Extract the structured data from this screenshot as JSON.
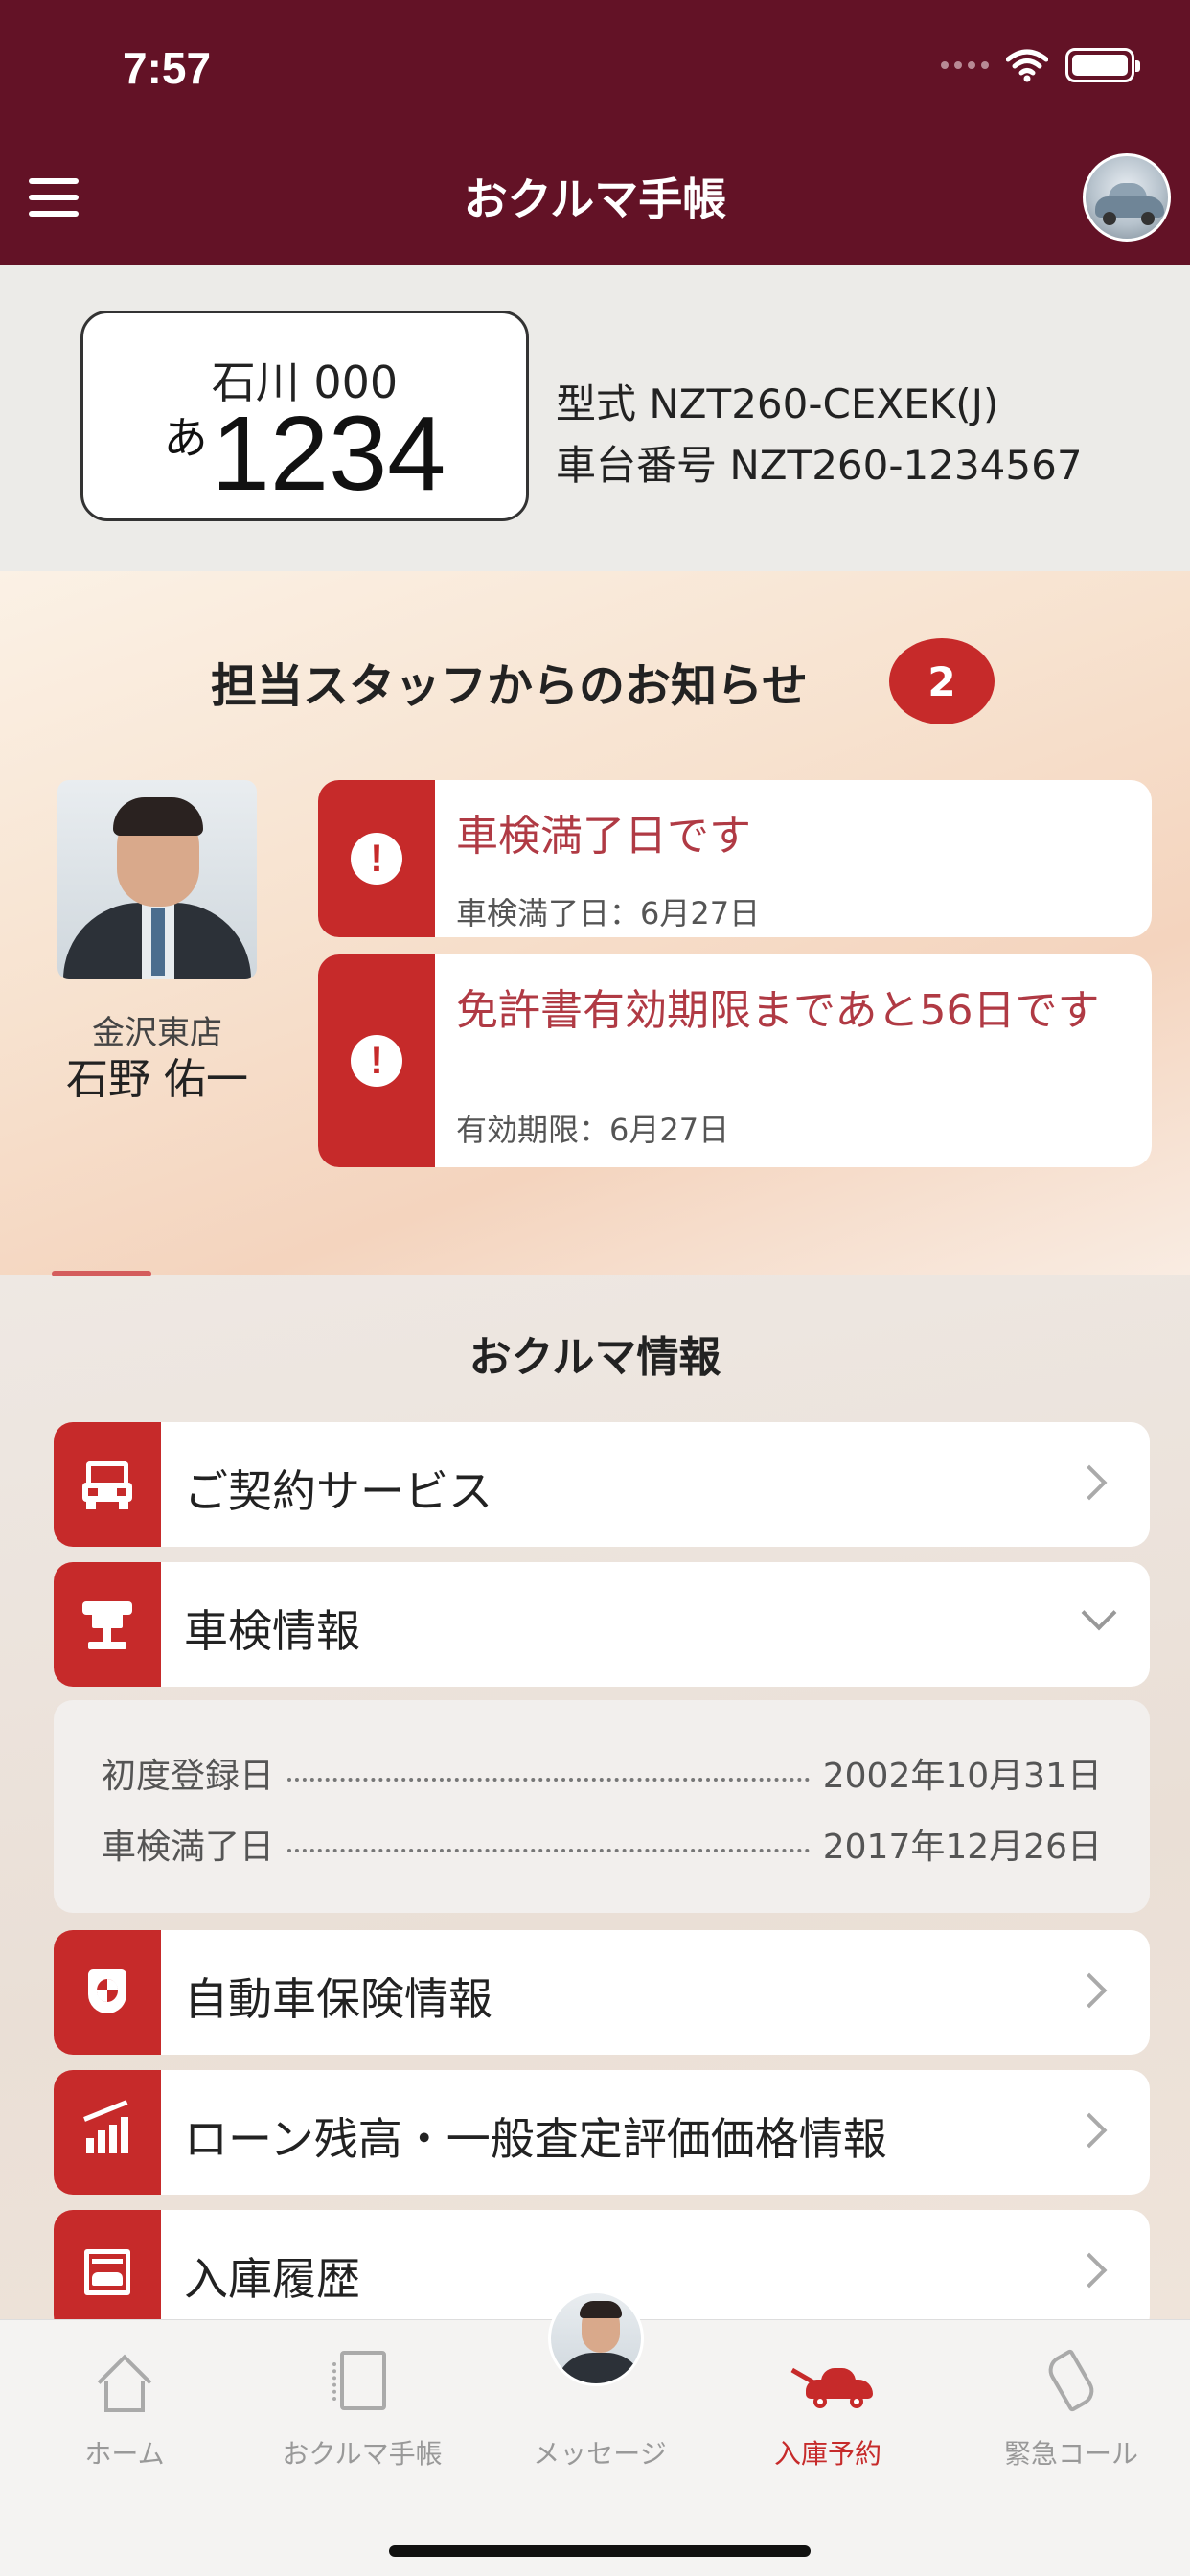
{
  "status": {
    "time": "7:57"
  },
  "nav": {
    "title": "おクルマ手帳"
  },
  "plate": {
    "region": "石川 000",
    "kana": "あ",
    "number": "1234"
  },
  "vehicle": {
    "model": "型式 NZT260-CEXEK(J)",
    "chassis": "車台番号 NZT260-1234567"
  },
  "notices": {
    "title": "担当スタッフからのお知らせ",
    "count": "2",
    "staff": {
      "store": "金沢東店",
      "name": "石野 佑一"
    },
    "items": [
      {
        "message": "車検満了日です",
        "detail": "車検満了日：6月27日"
      },
      {
        "message": "免許書有効期限まであと56日です",
        "detail": "有効期限：6月27日"
      }
    ]
  },
  "info": {
    "title": "おクルマ情報",
    "rows": [
      {
        "label": "ご契約サービス",
        "icon": "car-front-icon"
      },
      {
        "label": "車検情報",
        "icon": "car-lift-icon"
      },
      {
        "label": "自動車保険情報",
        "icon": "insurance-shield-icon"
      },
      {
        "label": "ローン残高・一般査定評価価格情報",
        "icon": "bar-chart-icon"
      },
      {
        "label": "入庫履歴",
        "icon": "garage-icon"
      }
    ],
    "inspection_details": [
      {
        "key": "初度登録日",
        "value": "2002年10月31日"
      },
      {
        "key": "車検満了日",
        "value": "2017年12月26日"
      }
    ]
  },
  "tabs": [
    {
      "label": "ホーム",
      "icon": "home-icon"
    },
    {
      "label": "おクルマ手帳",
      "icon": "notebook-icon"
    },
    {
      "label": "メッセージ",
      "icon": "staff-avatar"
    },
    {
      "label": "入庫予約",
      "icon": "tow-truck-icon"
    },
    {
      "label": "緊急コール",
      "icon": "phone-icon"
    }
  ],
  "colors": {
    "header": "#631226",
    "accent": "#c62a2a"
  }
}
